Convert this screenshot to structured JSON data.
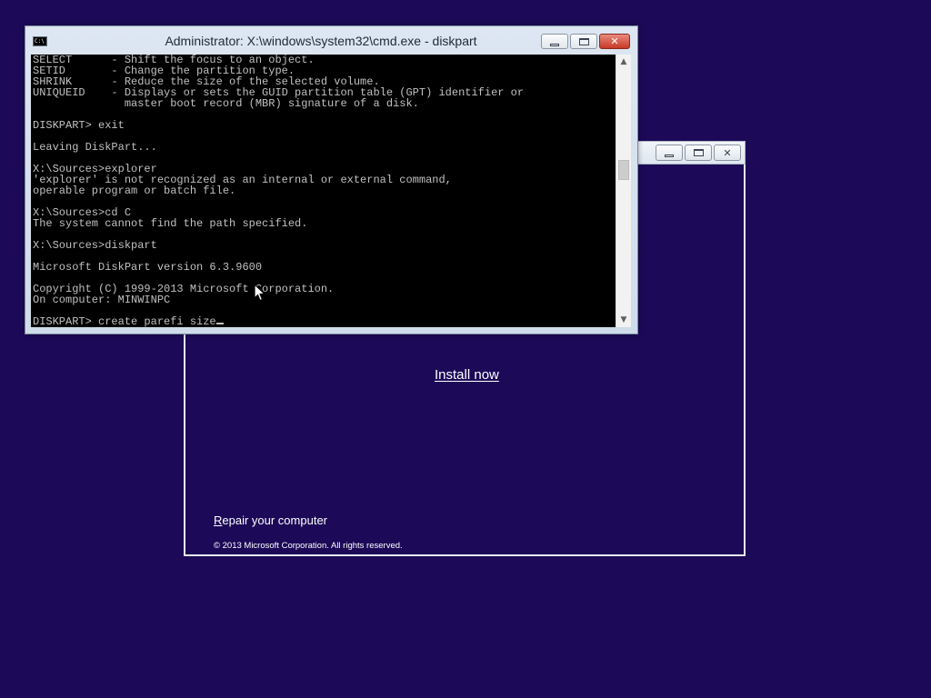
{
  "cmd_window": {
    "title": "Administrator: X:\\windows\\system32\\cmd.exe - diskpart",
    "icon_text": "C:\\",
    "console_lines": [
      "SELECT      - Shift the focus to an object.",
      "SETID       - Change the partition type.",
      "SHRINK      - Reduce the size of the selected volume.",
      "UNIQUEID    - Displays or sets the GUID partition table (GPT) identifier or",
      "              master boot record (MBR) signature of a disk.",
      "",
      "DISKPART> exit",
      "",
      "Leaving DiskPart...",
      "",
      "X:\\Sources>explorer",
      "'explorer' is not recognized as an internal or external command,",
      "operable program or batch file.",
      "",
      "X:\\Sources>cd C",
      "The system cannot find the path specified.",
      "",
      "X:\\Sources>diskpart",
      "",
      "Microsoft DiskPart version 6.3.9600",
      "",
      "Copyright (C) 1999-2013 Microsoft Corporation.",
      "On computer: MINWINPC",
      "",
      "DISKPART> create parefi size"
    ]
  },
  "setup_window": {
    "install_now_label": "Install now",
    "repair_label_first_letter": "R",
    "repair_label_rest": "epair your computer",
    "copyright": "© 2013 Microsoft Corporation. All rights reserved."
  },
  "icons": {
    "minimize": "minimize-icon",
    "maximize": "maximize-icon",
    "close": "close-icon",
    "scroll_up": "chevron-up-icon",
    "scroll_down": "chevron-down-icon",
    "pointer": "mouse-pointer-icon"
  },
  "colors": {
    "desktop_background": "#1c0a58",
    "console_background": "#000000",
    "console_text": "#c0c0c0",
    "close_button": "#c63a27"
  }
}
